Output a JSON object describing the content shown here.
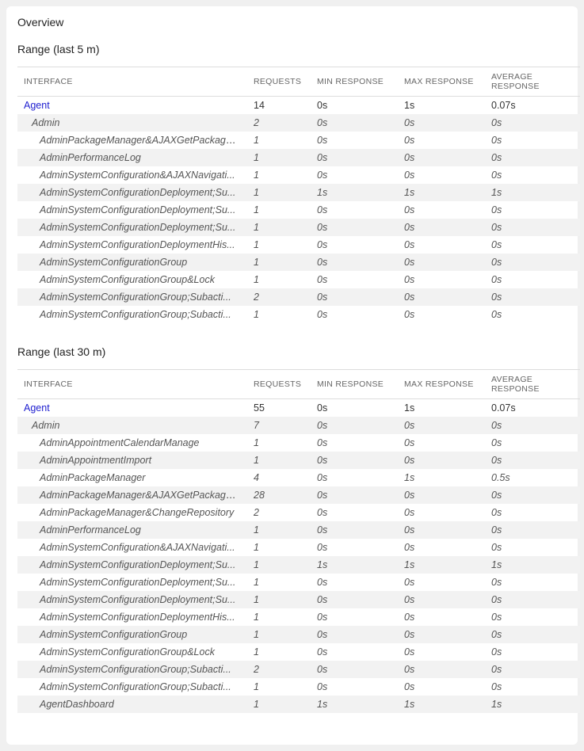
{
  "panel_title": "Overview",
  "headers": {
    "interface": "INTERFACE",
    "requests": "REQUESTS",
    "min_response": "MIN RESPONSE",
    "max_response": "MAX RESPONSE",
    "avg_response": "AVERAGE RESPONSE"
  },
  "ranges": [
    {
      "title": "Range (last 5 m)",
      "rows": [
        {
          "interface": "Agent",
          "requests": "14",
          "min": "0s",
          "max": "1s",
          "avg": "0.07s",
          "indent": 0,
          "italic": false
        },
        {
          "interface": "Admin",
          "requests": "2",
          "min": "0s",
          "max": "0s",
          "avg": "0s",
          "indent": 1,
          "italic": true
        },
        {
          "interface": "AdminPackageManager&AJAXGetPackageUpg...",
          "requests": "1",
          "min": "0s",
          "max": "0s",
          "avg": "0s",
          "indent": 2,
          "italic": true
        },
        {
          "interface": "AdminPerformanceLog",
          "requests": "1",
          "min": "0s",
          "max": "0s",
          "avg": "0s",
          "indent": 2,
          "italic": true
        },
        {
          "interface": "AdminSystemConfiguration&AJAXNavigati...",
          "requests": "1",
          "min": "0s",
          "max": "0s",
          "avg": "0s",
          "indent": 2,
          "italic": true
        },
        {
          "interface": "AdminSystemConfigurationDeployment;Su...",
          "requests": "1",
          "min": "1s",
          "max": "1s",
          "avg": "1s",
          "indent": 2,
          "italic": true
        },
        {
          "interface": "AdminSystemConfigurationDeployment;Su...",
          "requests": "1",
          "min": "0s",
          "max": "0s",
          "avg": "0s",
          "indent": 2,
          "italic": true
        },
        {
          "interface": "AdminSystemConfigurationDeployment;Su...",
          "requests": "1",
          "min": "0s",
          "max": "0s",
          "avg": "0s",
          "indent": 2,
          "italic": true
        },
        {
          "interface": "AdminSystemConfigurationDeploymentHis...",
          "requests": "1",
          "min": "0s",
          "max": "0s",
          "avg": "0s",
          "indent": 2,
          "italic": true
        },
        {
          "interface": "AdminSystemConfigurationGroup",
          "requests": "1",
          "min": "0s",
          "max": "0s",
          "avg": "0s",
          "indent": 2,
          "italic": true
        },
        {
          "interface": "AdminSystemConfigurationGroup&Lock",
          "requests": "1",
          "min": "0s",
          "max": "0s",
          "avg": "0s",
          "indent": 2,
          "italic": true
        },
        {
          "interface": "AdminSystemConfigurationGroup;Subacti...",
          "requests": "2",
          "min": "0s",
          "max": "0s",
          "avg": "0s",
          "indent": 2,
          "italic": true
        },
        {
          "interface": "AdminSystemConfigurationGroup;Subacti...",
          "requests": "1",
          "min": "0s",
          "max": "0s",
          "avg": "0s",
          "indent": 2,
          "italic": true
        }
      ]
    },
    {
      "title": "Range (last 30 m)",
      "rows": [
        {
          "interface": "Agent",
          "requests": "55",
          "min": "0s",
          "max": "1s",
          "avg": "0.07s",
          "indent": 0,
          "italic": false
        },
        {
          "interface": "Admin",
          "requests": "7",
          "min": "0s",
          "max": "0s",
          "avg": "0s",
          "indent": 1,
          "italic": true
        },
        {
          "interface": "AdminAppointmentCalendarManage",
          "requests": "1",
          "min": "0s",
          "max": "0s",
          "avg": "0s",
          "indent": 2,
          "italic": true
        },
        {
          "interface": "AdminAppointmentImport",
          "requests": "1",
          "min": "0s",
          "max": "0s",
          "avg": "0s",
          "indent": 2,
          "italic": true
        },
        {
          "interface": "AdminPackageManager",
          "requests": "4",
          "min": "0s",
          "max": "1s",
          "avg": "0.5s",
          "indent": 2,
          "italic": true
        },
        {
          "interface": "AdminPackageManager&AJAXGetPackageUpg...",
          "requests": "28",
          "min": "0s",
          "max": "0s",
          "avg": "0s",
          "indent": 2,
          "italic": true
        },
        {
          "interface": "AdminPackageManager&ChangeRepository",
          "requests": "2",
          "min": "0s",
          "max": "0s",
          "avg": "0s",
          "indent": 2,
          "italic": true
        },
        {
          "interface": "AdminPerformanceLog",
          "requests": "1",
          "min": "0s",
          "max": "0s",
          "avg": "0s",
          "indent": 2,
          "italic": true
        },
        {
          "interface": "AdminSystemConfiguration&AJAXNavigati...",
          "requests": "1",
          "min": "0s",
          "max": "0s",
          "avg": "0s",
          "indent": 2,
          "italic": true
        },
        {
          "interface": "AdminSystemConfigurationDeployment;Su...",
          "requests": "1",
          "min": "1s",
          "max": "1s",
          "avg": "1s",
          "indent": 2,
          "italic": true
        },
        {
          "interface": "AdminSystemConfigurationDeployment;Su...",
          "requests": "1",
          "min": "0s",
          "max": "0s",
          "avg": "0s",
          "indent": 2,
          "italic": true
        },
        {
          "interface": "AdminSystemConfigurationDeployment;Su...",
          "requests": "1",
          "min": "0s",
          "max": "0s",
          "avg": "0s",
          "indent": 2,
          "italic": true
        },
        {
          "interface": "AdminSystemConfigurationDeploymentHis...",
          "requests": "1",
          "min": "0s",
          "max": "0s",
          "avg": "0s",
          "indent": 2,
          "italic": true
        },
        {
          "interface": "AdminSystemConfigurationGroup",
          "requests": "1",
          "min": "0s",
          "max": "0s",
          "avg": "0s",
          "indent": 2,
          "italic": true
        },
        {
          "interface": "AdminSystemConfigurationGroup&Lock",
          "requests": "1",
          "min": "0s",
          "max": "0s",
          "avg": "0s",
          "indent": 2,
          "italic": true
        },
        {
          "interface": "AdminSystemConfigurationGroup;Subacti...",
          "requests": "2",
          "min": "0s",
          "max": "0s",
          "avg": "0s",
          "indent": 2,
          "italic": true
        },
        {
          "interface": "AdminSystemConfigurationGroup;Subacti...",
          "requests": "1",
          "min": "0s",
          "max": "0s",
          "avg": "0s",
          "indent": 2,
          "italic": true
        },
        {
          "interface": "AgentDashboard",
          "requests": "1",
          "min": "1s",
          "max": "1s",
          "avg": "1s",
          "indent": 2,
          "italic": true
        }
      ]
    }
  ]
}
